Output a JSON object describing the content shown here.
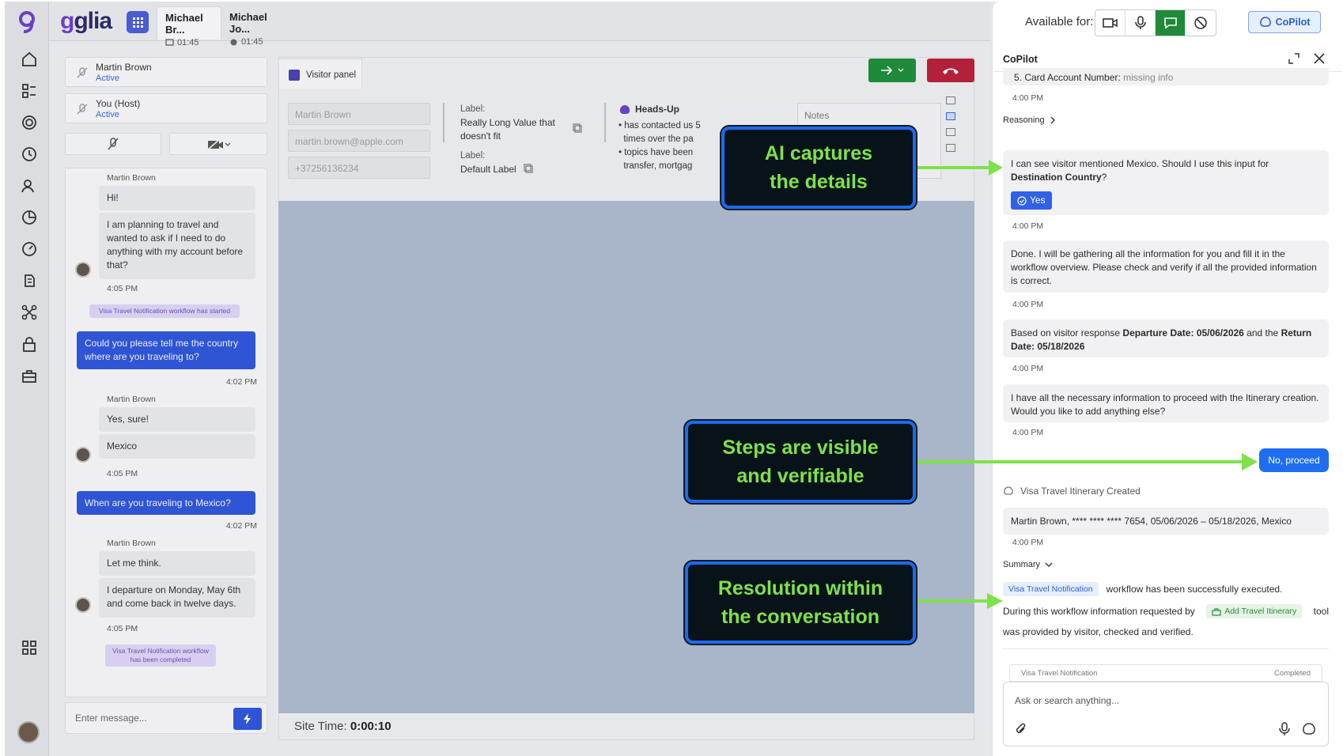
{
  "brand": {
    "name": "glia"
  },
  "top_tabs": [
    {
      "name": "Michael Br...",
      "time": "01:45"
    },
    {
      "name": "Michael Jo...",
      "time": "01:45"
    }
  ],
  "participants": [
    {
      "name": "Martin Brown",
      "status": "Active"
    },
    {
      "name": "You (Host)",
      "status": "Active"
    }
  ],
  "chat": {
    "visitor_name": "Martin Brown",
    "m1": "Hi!",
    "m2": "I am planning to travel and wanted to ask if I need to do anything with my account before that?",
    "t1": "4:05 PM",
    "sys1": "Visa Travel Notification workflow has started",
    "a1": "Could you please tell me the country where are you traveling to?",
    "at1": "4:02 PM",
    "m3": "Yes, sure!",
    "m4": "Mexico",
    "t2": "4:05 PM",
    "a2": "When are you traveling to Mexico?",
    "at2": "4:02 PM",
    "m5": "Let me think.",
    "m6": "I departure on Monday, May 6th and come back in twelve days.",
    "t3": "4:05 PM",
    "sys2": "Visa Travel Notification workflow has been completed",
    "composer_placeholder": "Enter message..."
  },
  "visitor_panel": {
    "tab_label": "Visitor panel",
    "fields": [
      "Martin Brown",
      "martin.brown@apple.com",
      "+37256136234"
    ],
    "label1": "Label:",
    "value1": "Really Long Value that doesn't fit",
    "label2": "Label:",
    "value2": "Default Label",
    "headsup_title": "Heads-Up",
    "headsup_items": [
      "has contacted us 5",
      "times over the pa",
      "topics have been",
      "transfer, mortgag"
    ],
    "notes_placeholder": "Notes",
    "site_time_label": "Site Time:",
    "site_time_value": "0:00:10"
  },
  "copilot": {
    "available_for": "Available for:",
    "button_label": "CoPilot",
    "title": "CoPilot",
    "top_item": "5. Card Account Number:",
    "top_item_status": "missing info",
    "time_0": "4:00 PM",
    "reasoning": "Reasoning",
    "msg1_a": "I can see visitor mentioned Mexico. Should I use this input for",
    "msg1_b": "Destination Country",
    "msg1_c": "?",
    "yes_label": "Yes",
    "time_1": "4:00 PM",
    "msg2": "Done. I will be gathering all the information for you and fill it in the workflow overview. Please check and verify if all the provided information is correct.",
    "time_2": "4:00 PM",
    "msg3_a": "Based on visitor response",
    "msg3_b": "Departure Date: 05/06/2026",
    "msg3_c": "and the",
    "msg3_d": "Return Date: 05/18/2026",
    "time_3": "4:00 PM",
    "msg4": "I have all the necessary information to proceed with the Itinerary creation. Would you like to add anything else?",
    "time_4": "4:00 PM",
    "proceed_label": "No, proceed",
    "itinerary_title": "Visa Travel Itinerary Created",
    "itinerary_value": "Martin Brown, **** **** **** 7654, 05/06/2026 – 05/18/2026, Mexico",
    "time_5": "4:00 PM",
    "summary_label": "Summary",
    "summary_tag": "Visa Travel Notification",
    "summary_text1": "workflow has been successfully executed.",
    "summary_text2": "During this workflow information requested by",
    "summary_tool": "Add Travel Itinerary",
    "summary_text3": "tool",
    "summary_text4": "was provided by visitor, checked and verified.",
    "card_name": "Visa Travel Notification",
    "card_status": "Completed",
    "ask_placeholder": "Ask or search anything..."
  },
  "callouts": [
    {
      "line1": "AI captures",
      "line2": "the details"
    },
    {
      "line1": "Steps are visible",
      "line2": "and verifiable"
    },
    {
      "line1": "Resolution within",
      "line2": "the conversation"
    }
  ],
  "colors": {
    "accent_green": "#7de24b",
    "callout_border": "#1c6af0",
    "agent_blue": "#2f55d4"
  }
}
